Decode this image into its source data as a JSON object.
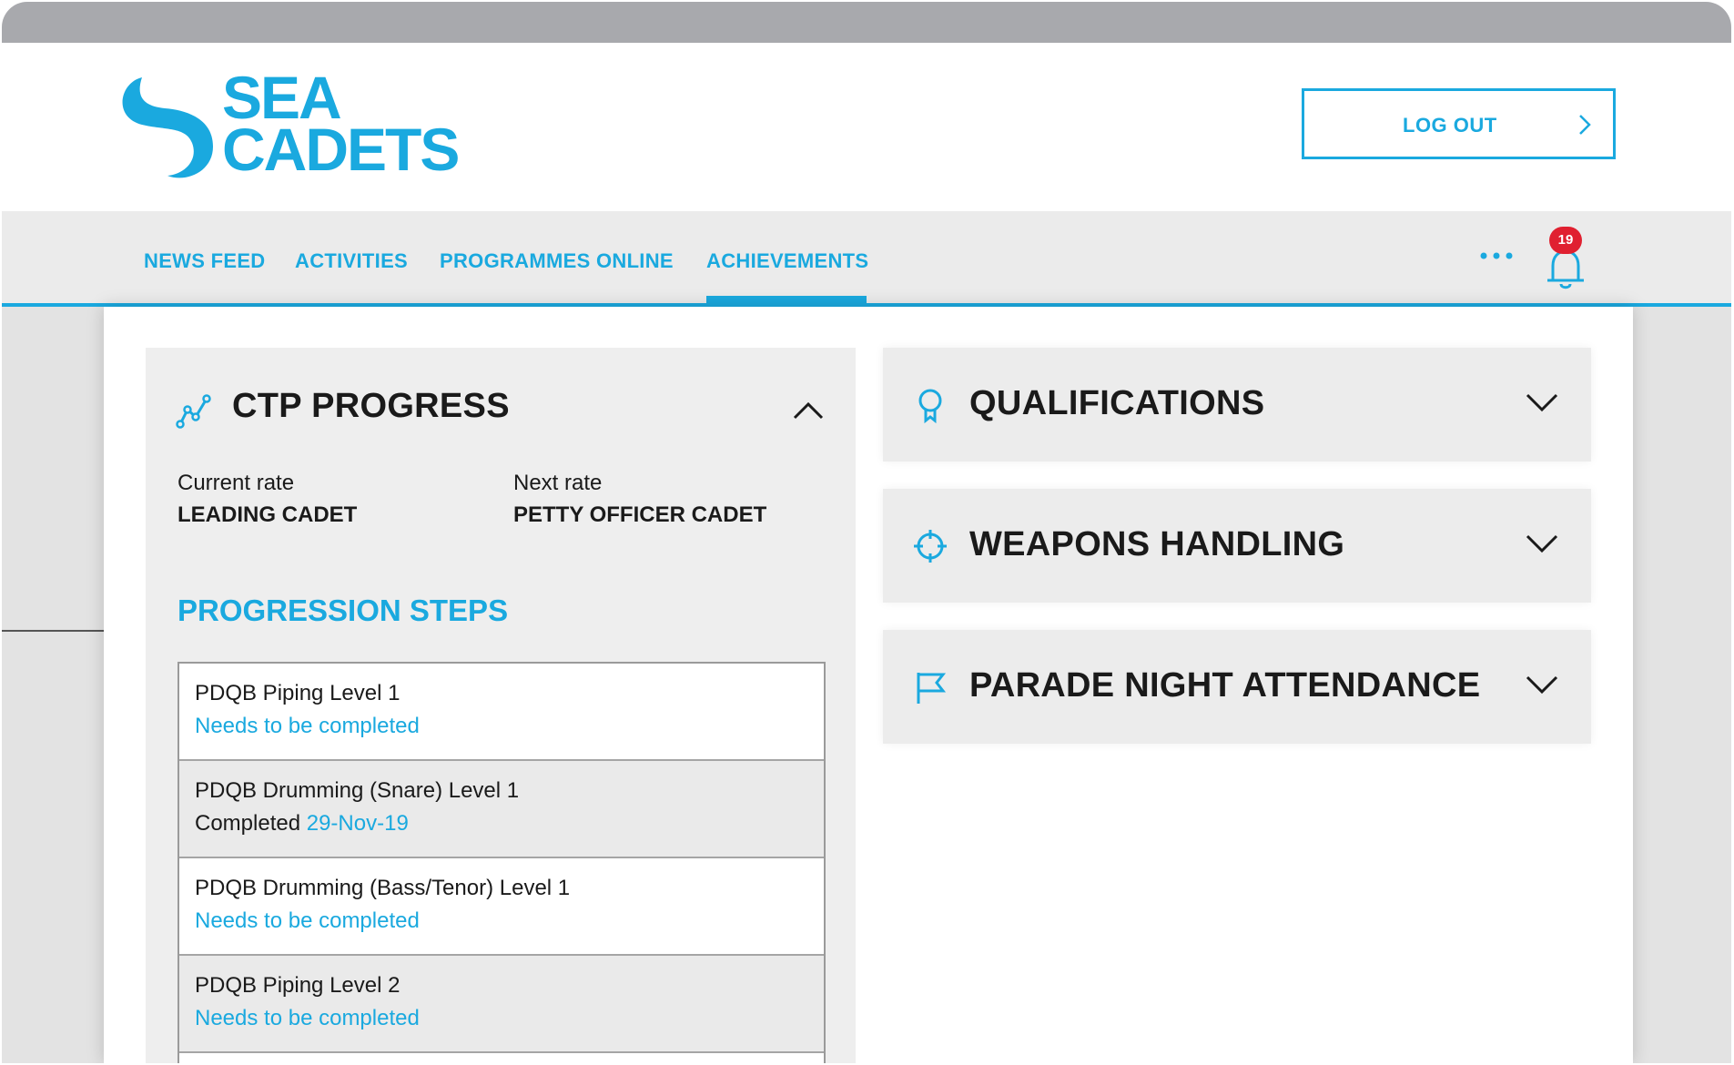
{
  "header": {
    "logo_text_line1": "SEA",
    "logo_text_line2": "CADETS",
    "logout_label": "LOG OUT"
  },
  "nav": {
    "items": [
      {
        "label": "NEWS FEED",
        "active": false
      },
      {
        "label": "ACTIVITIES",
        "active": false
      },
      {
        "label": "PROGRAMMES ONLINE",
        "active": false
      },
      {
        "label": "ACHIEVEMENTS",
        "active": true
      }
    ],
    "more_icon": "more-dots-icon",
    "notifications_icon": "bell-icon",
    "notification_count": "19"
  },
  "ctp": {
    "title": "CTP PROGRESS",
    "icon": "progress-chart-icon",
    "current_rate_label": "Current rate",
    "current_rate_value": "LEADING CADET",
    "next_rate_label": "Next rate",
    "next_rate_value": "PETTY OFFICER CADET",
    "steps_title": "PROGRESSION STEPS",
    "steps": [
      {
        "name": "PDQB Piping Level 1",
        "status": "Needs to be completed",
        "completed_word": "",
        "date": ""
      },
      {
        "name": "PDQB Drumming (Snare) Level 1",
        "status": "",
        "completed_word": "Completed",
        "date": "29-Nov-19"
      },
      {
        "name": "PDQB Drumming (Bass/Tenor) Level 1",
        "status": "Needs to be completed",
        "completed_word": "",
        "date": ""
      },
      {
        "name": "PDQB Piping Level 2",
        "status": "Needs to be completed",
        "completed_word": "",
        "date": ""
      }
    ]
  },
  "accordions": [
    {
      "title": "QUALIFICATIONS",
      "icon": "award-ribbon-icon"
    },
    {
      "title": "WEAPONS HANDLING",
      "icon": "crosshair-icon"
    },
    {
      "title": "PARADE NIGHT ATTENDANCE",
      "icon": "flag-icon"
    }
  ],
  "colors": {
    "brand_blue": "#1aa9df",
    "badge_red": "#e02030",
    "card_grey": "#eeeeee"
  }
}
